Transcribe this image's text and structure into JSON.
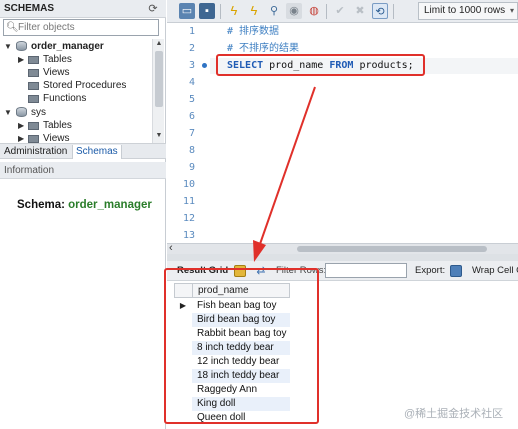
{
  "sidebar": {
    "title": "SCHEMAS",
    "refresh_icon": "refresh-icon",
    "filter_placeholder": "Filter objects",
    "tree": [
      {
        "label": "order_manager",
        "level": 0,
        "type": "schema",
        "expanded": true
      },
      {
        "label": "Tables",
        "level": 1,
        "type": "folder"
      },
      {
        "label": "Views",
        "level": 1,
        "type": "folder"
      },
      {
        "label": "Stored Procedures",
        "level": 1,
        "type": "folder"
      },
      {
        "label": "Functions",
        "level": 1,
        "type": "folder"
      },
      {
        "label": "sys",
        "level": 0,
        "type": "schema",
        "expanded": true
      },
      {
        "label": "Tables",
        "level": 1,
        "type": "folder"
      },
      {
        "label": "Views",
        "level": 1,
        "type": "folder"
      }
    ],
    "tabs": [
      "Administration",
      "Schemas"
    ],
    "active_tab": "Schemas",
    "info_title": "Information",
    "schema_label": "Schema:",
    "schema_value": "order_manager"
  },
  "toolbar": {
    "limit_label": "Limit to 1000 rows"
  },
  "editor": {
    "line_numbers": [
      "1",
      "2",
      "3",
      "4",
      "5",
      "6",
      "7",
      "8",
      "9",
      "10",
      "11",
      "12",
      "13"
    ],
    "lines": [
      {
        "comment": "# 排序数据"
      },
      {
        "comment": "# 不排序的结果"
      },
      {
        "kw1": "SELECT",
        "mid": " prod_name ",
        "kw2": "FROM",
        "tail": " products;"
      }
    ]
  },
  "result_toolbar": {
    "grid_label": "Result Grid",
    "filter_label": "Filter Rows:",
    "filter_value": "",
    "export_label": "Export:",
    "wrap_label": "Wrap Cell C"
  },
  "grid": {
    "column": "prod_name",
    "rows": [
      "Fish bean bag toy",
      "Bird bean bag toy",
      "Rabbit bean bag toy",
      "8 inch teddy bear",
      "12 inch teddy bear",
      "18 inch teddy bear",
      "Raggedy Ann",
      "King doll",
      "Queen doll"
    ]
  },
  "watermark": "@稀土掘金技术社区",
  "colors": {
    "annotation": "#e0302a",
    "keyword": "#1f5bb5",
    "comment": "#3e7fc2",
    "schema_value": "#2a7d2a"
  }
}
